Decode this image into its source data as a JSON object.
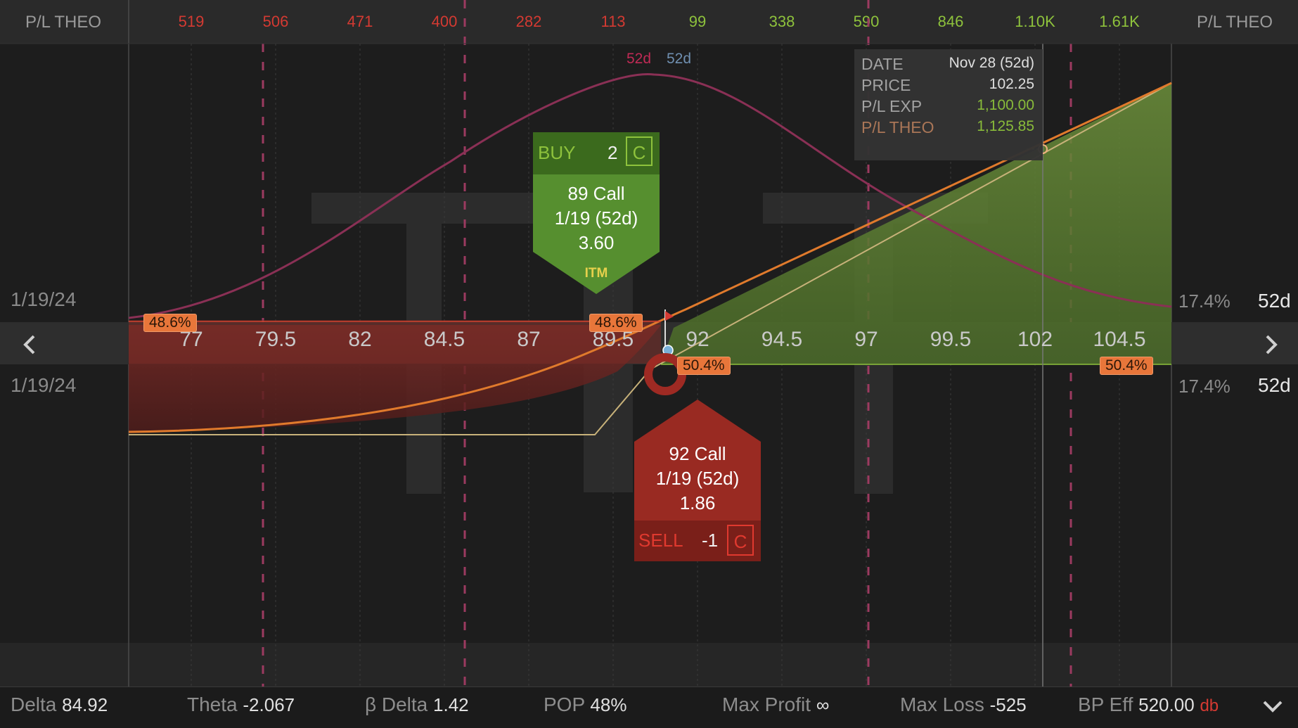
{
  "header": {
    "left_label": "P/L THEO",
    "right_label": "P/L THEO",
    "values": [
      {
        "text": "519",
        "tone": "neg"
      },
      {
        "text": "506",
        "tone": "neg"
      },
      {
        "text": "471",
        "tone": "neg"
      },
      {
        "text": "400",
        "tone": "neg"
      },
      {
        "text": "282",
        "tone": "neg"
      },
      {
        "text": "113",
        "tone": "neg"
      },
      {
        "text": "99",
        "tone": "pos"
      },
      {
        "text": "338",
        "tone": "pos"
      },
      {
        "text": "590",
        "tone": "pos"
      },
      {
        "text": "846",
        "tone": "pos"
      },
      {
        "text": "1.10K",
        "tone": "pos"
      },
      {
        "text": "1.61K",
        "tone": "pos"
      }
    ]
  },
  "price_axis": [
    "77",
    "79.5",
    "82",
    "84.5",
    "87",
    "89.5",
    "92",
    "94.5",
    "97",
    "99.5",
    "102",
    "104.5"
  ],
  "upper_row": {
    "date": "1/19/24",
    "iv": "17.4%",
    "dte": "52d"
  },
  "lower_row": {
    "date": "1/19/24",
    "iv": "17.4%",
    "dte": "52d"
  },
  "curve_labels": {
    "a": "52d",
    "b": "52d"
  },
  "prob_badges": {
    "left": "48.6%",
    "mid": "48.6%",
    "center": "50.4%",
    "right": "50.4%"
  },
  "buy_tag": {
    "action": "BUY",
    "qty": "2",
    "type": "C",
    "strike": "89 Call",
    "expiry": "1/19 (52d)",
    "price": "3.60",
    "moneyness": "ITM"
  },
  "sell_tag": {
    "action": "SELL",
    "qty": "-1",
    "type": "C",
    "strike": "92 Call",
    "expiry": "1/19 (52d)",
    "price": "1.86"
  },
  "tooltip": {
    "date_label": "DATE",
    "date_value": "Nov 28 (52d)",
    "price_label": "PRICE",
    "price_value": "102.25",
    "pl_exp_label": "P/L EXP",
    "pl_exp_value": "1,100.00",
    "pl_theo_label": "P/L THEO",
    "pl_theo_value": "1,125.85"
  },
  "stats": {
    "delta_label": "Delta",
    "delta_value": "84.92",
    "theta_label": "Theta",
    "theta_value": "-2.067",
    "beta_delta_label": "β Delta",
    "beta_delta_value": "1.42",
    "pop_label": "POP",
    "pop_value": "48%",
    "max_profit_label": "Max Profit",
    "max_profit_value": "∞",
    "max_loss_label": "Max Loss",
    "max_loss_value": "-525",
    "bp_eff_label": "BP Eff",
    "bp_eff_value": "520.00",
    "bp_eff_unit": "db"
  },
  "colors": {
    "loss_fill": "#6b2222",
    "profit_fill": "#5d7f34",
    "theo_line": "#e07a2c",
    "exp_line": "#c8b27a",
    "prob_curve": "#8a3055",
    "buy_green": "#4f8a2a",
    "sell_red": "#992a22"
  }
}
